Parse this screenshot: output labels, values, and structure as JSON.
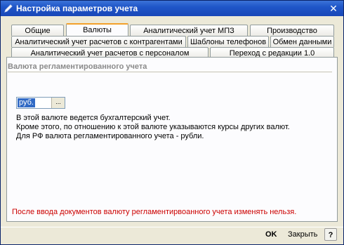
{
  "window": {
    "title": "Настройка параметров учета",
    "close_glyph": "✕"
  },
  "tabs": {
    "row1": [
      "Общие",
      "Валюты",
      "Аналитический учет МПЗ",
      "Производство"
    ],
    "row2": [
      "Аналитический учет расчетов с контрагентами",
      "Шаблоны телефонов",
      "Обмен данными"
    ],
    "row3": [
      "Аналитический учет расчетов с персоналом",
      "Переход с редакции 1.0"
    ],
    "active": "Валюты"
  },
  "group": {
    "title": "Валюта регламентированного учета"
  },
  "currency": {
    "value": "руб.",
    "select_label": "..."
  },
  "info": [
    "В этой валюте ведется бухгалтерский учет.",
    "Кроме этого, по отношению к этой валюте указываются курсы других валют.",
    "Для РФ валюта регламентированного учета - рубли."
  ],
  "warning": "После ввода документов валюту регламентирвоанного учета изменять нельзя.",
  "footer": {
    "ok_label": "OK",
    "close_label": "Закрыть",
    "help_label": "?"
  },
  "colors": {
    "title_bar": "#1f56c8",
    "warning": "#cc0000",
    "active_tab_accent": "#f3a12b"
  }
}
